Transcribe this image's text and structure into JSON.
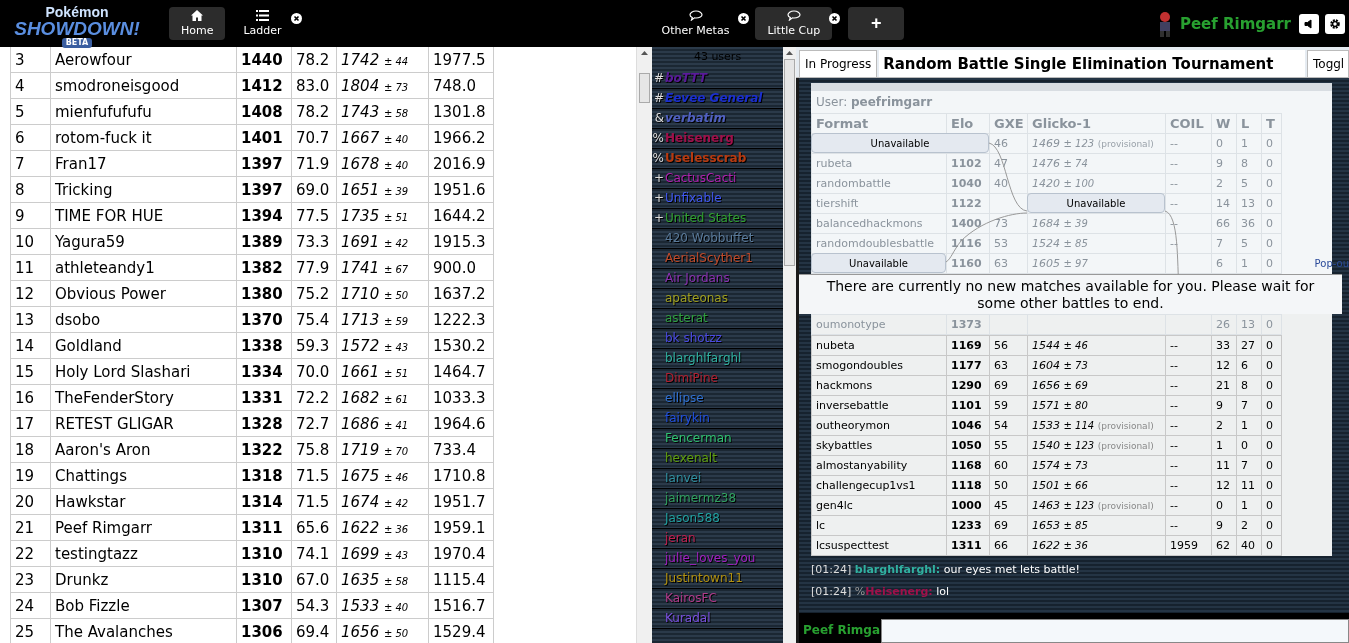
{
  "header": {
    "logo": {
      "top": "Pokémon",
      "main": "SHOWDOWN!",
      "badge": "BETA"
    },
    "tabs": [
      {
        "kind": "home",
        "label": "Home",
        "selected": true,
        "closable": false
      },
      {
        "kind": "ladder",
        "label": "Ladder",
        "selected": false,
        "closable": true
      }
    ],
    "rooms": [
      {
        "label": "Other Metas",
        "selected": false,
        "closable": true
      },
      {
        "label": "Little Cup",
        "selected": true,
        "closable": true
      }
    ],
    "add_button": "+",
    "user": {
      "name": "Peef Rimgarr"
    }
  },
  "ladder": {
    "rows": [
      {
        "rank": "3",
        "name": "Aerowfour",
        "elo": "1440",
        "gxe": "78.2",
        "glicko": "1742",
        "dev": "± 44",
        "coil": "1977.5"
      },
      {
        "rank": "4",
        "name": "smodroneisgood",
        "elo": "1412",
        "gxe": "83.0",
        "glicko": "1804",
        "dev": "± 73",
        "coil": "748.0"
      },
      {
        "rank": "5",
        "name": "mienfufufufu",
        "elo": "1408",
        "gxe": "78.2",
        "glicko": "1743",
        "dev": "± 58",
        "coil": "1301.8"
      },
      {
        "rank": "6",
        "name": "rotom-fuck it",
        "elo": "1401",
        "gxe": "70.7",
        "glicko": "1667",
        "dev": "± 40",
        "coil": "1966.2"
      },
      {
        "rank": "7",
        "name": "Fran17",
        "elo": "1397",
        "gxe": "71.9",
        "glicko": "1678",
        "dev": "± 40",
        "coil": "2016.9"
      },
      {
        "rank": "8",
        "name": "Tricking",
        "elo": "1397",
        "gxe": "69.0",
        "glicko": "1651",
        "dev": "± 39",
        "coil": "1951.6"
      },
      {
        "rank": "9",
        "name": "TIME FOR HUE",
        "elo": "1394",
        "gxe": "77.5",
        "glicko": "1735",
        "dev": "± 51",
        "coil": "1644.2"
      },
      {
        "rank": "10",
        "name": "Yagura59",
        "elo": "1389",
        "gxe": "73.3",
        "glicko": "1691",
        "dev": "± 42",
        "coil": "1915.3"
      },
      {
        "rank": "11",
        "name": "athleteandy1",
        "elo": "1382",
        "gxe": "77.9",
        "glicko": "1741",
        "dev": "± 67",
        "coil": "900.0"
      },
      {
        "rank": "12",
        "name": "Obvious Power",
        "elo": "1380",
        "gxe": "75.2",
        "glicko": "1710",
        "dev": "± 50",
        "coil": "1637.2"
      },
      {
        "rank": "13",
        "name": "dsobo",
        "elo": "1370",
        "gxe": "75.4",
        "glicko": "1713",
        "dev": "± 59",
        "coil": "1222.3"
      },
      {
        "rank": "14",
        "name": "Goldland",
        "elo": "1338",
        "gxe": "59.3",
        "glicko": "1572",
        "dev": "± 43",
        "coil": "1530.2"
      },
      {
        "rank": "15",
        "name": "Holy Lord Slashari",
        "elo": "1334",
        "gxe": "70.0",
        "glicko": "1661",
        "dev": "± 51",
        "coil": "1464.7"
      },
      {
        "rank": "16",
        "name": "TheFenderStory",
        "elo": "1331",
        "gxe": "72.2",
        "glicko": "1682",
        "dev": "± 61",
        "coil": "1033.3"
      },
      {
        "rank": "17",
        "name": "RETEST GLIGAR",
        "elo": "1328",
        "gxe": "72.7",
        "glicko": "1686",
        "dev": "± 41",
        "coil": "1964.6"
      },
      {
        "rank": "18",
        "name": "Aaron's Aron",
        "elo": "1322",
        "gxe": "75.8",
        "glicko": "1719",
        "dev": "± 70",
        "coil": "733.4"
      },
      {
        "rank": "19",
        "name": "Chattings",
        "elo": "1318",
        "gxe": "71.5",
        "glicko": "1675",
        "dev": "± 46",
        "coil": "1710.8"
      },
      {
        "rank": "20",
        "name": "Hawkstar",
        "elo": "1314",
        "gxe": "71.5",
        "glicko": "1674",
        "dev": "± 42",
        "coil": "1951.7"
      },
      {
        "rank": "21",
        "name": "Peef Rimgarr",
        "elo": "1311",
        "gxe": "65.6",
        "glicko": "1622",
        "dev": "± 36",
        "coil": "1959.1"
      },
      {
        "rank": "22",
        "name": "testingtazz",
        "elo": "1310",
        "gxe": "74.1",
        "glicko": "1699",
        "dev": "± 43",
        "coil": "1970.4"
      },
      {
        "rank": "23",
        "name": "Drunkz",
        "elo": "1310",
        "gxe": "67.0",
        "glicko": "1635",
        "dev": "± 58",
        "coil": "1115.4"
      },
      {
        "rank": "24",
        "name": "Bob Fizzle",
        "elo": "1307",
        "gxe": "54.3",
        "glicko": "1533",
        "dev": "± 40",
        "coil": "1516.7"
      },
      {
        "rank": "25",
        "name": "The Avalanches",
        "elo": "1306",
        "gxe": "69.4",
        "glicko": "1656",
        "dev": "± 50",
        "coil": "1529.4"
      }
    ]
  },
  "userlist": {
    "count": "43 users",
    "users": [
      {
        "group": "#",
        "name": "boTTT",
        "color": "#5a1a9a",
        "kind": "staff"
      },
      {
        "group": "#",
        "name": "Eevee General",
        "color": "#1a2fd0",
        "kind": "staff"
      },
      {
        "group": "&",
        "name": "verbatim",
        "color": "#5060c0",
        "kind": "staff"
      },
      {
        "group": "%",
        "name": "Heisenerg",
        "color": "#a0104a",
        "kind": "driver"
      },
      {
        "group": "%",
        "name": "Uselesscrab",
        "color": "#b83a10",
        "kind": "driver"
      },
      {
        "group": "+",
        "name": "CactusCacti",
        "color": "#b020b0",
        "kind": "regular"
      },
      {
        "group": "+",
        "name": "Unfixable",
        "color": "#4058f0",
        "kind": "regular"
      },
      {
        "group": "+",
        "name": "United States",
        "color": "#30a030",
        "kind": "regular"
      },
      {
        "name": "420 Wobbuffet",
        "color": "#5a7a9a",
        "kind": "regular"
      },
      {
        "name": "AerialScyther1",
        "color": "#c04a2a",
        "kind": "regular"
      },
      {
        "name": "Air Jordans",
        "color": "#8a30b0",
        "kind": "regular"
      },
      {
        "name": "apateonas",
        "color": "#a0a020",
        "kind": "regular"
      },
      {
        "name": "asterat",
        "color": "#30a040",
        "kind": "regular"
      },
      {
        "name": "bk shotzz",
        "color": "#4a4ae0",
        "kind": "regular"
      },
      {
        "name": "blarghlfarghl",
        "color": "#30b0a0",
        "kind": "regular"
      },
      {
        "name": "DimiPine",
        "color": "#b02030",
        "kind": "regular"
      },
      {
        "name": "ellipse",
        "color": "#3070d0",
        "kind": "regular"
      },
      {
        "name": "fairykin",
        "color": "#2050e0",
        "kind": "regular"
      },
      {
        "name": "Fencerman",
        "color": "#30c070",
        "kind": "regular"
      },
      {
        "name": "hexenalt",
        "color": "#60a010",
        "kind": "regular"
      },
      {
        "name": "Ianvei",
        "color": "#3090a0",
        "kind": "regular"
      },
      {
        "name": "jaimermz38",
        "color": "#30a060",
        "kind": "regular"
      },
      {
        "name": "Jason588",
        "color": "#20a0a0",
        "kind": "regular"
      },
      {
        "name": "jeran",
        "color": "#c02050",
        "kind": "regular"
      },
      {
        "name": "julie_loves_you",
        "color": "#a020c0",
        "kind": "regular"
      },
      {
        "name": "Justintown11",
        "color": "#b09010",
        "kind": "regular"
      },
      {
        "name": "KairosFC",
        "color": "#b03a8a",
        "kind": "regular"
      },
      {
        "name": "Kuradal",
        "color": "#7a50e0",
        "kind": "regular"
      }
    ]
  },
  "tournament": {
    "tab": "In Progress",
    "title": "Random Battle Single Elimination Tournament",
    "toggle": "Toggl",
    "bracket_nodes": [
      "Unavailable",
      "Unavailable",
      "Unavailable"
    ],
    "popout": "Pop-ou",
    "message": "There are currently no new matches available for you. Please wait for some other battles to end."
  },
  "stats": {
    "user_label": "User:",
    "user": "peefrimgarr",
    "columns": [
      "Format",
      "Elo",
      "GXE",
      "Glicko-1",
      "COIL",
      "W",
      "L",
      "T"
    ],
    "faded_rows": [
      {
        "gxe": "46",
        "glicko": "1469",
        "dev": "± 123",
        "provisional": "(provisional)",
        "coil": "--",
        "w": "0",
        "l": "1",
        "t": "0"
      },
      {
        "format": "rubeta",
        "elo": "1102",
        "gxe": "47",
        "glicko": "1476",
        "dev": "± 74",
        "coil": "--",
        "w": "9",
        "l": "8",
        "t": "0"
      },
      {
        "format": "randombattle",
        "elo": "1040",
        "gxe": "40",
        "glicko": "1420",
        "dev": "± 100",
        "coil": "--",
        "w": "2",
        "l": "5",
        "t": "0"
      },
      {
        "format": "tiershift",
        "elo": "1122",
        "coil": "--",
        "w": "14",
        "l": "13",
        "t": "0"
      },
      {
        "format": "balancedhackmons",
        "elo": "1400",
        "gxe": "73",
        "glicko": "1684",
        "dev": "± 39",
        "coil": "--",
        "w": "66",
        "l": "36",
        "t": "0"
      },
      {
        "format": "randomdoublesbattle",
        "elo": "1116",
        "gxe": "53",
        "glicko": "1524",
        "dev": "± 85",
        "coil": "--",
        "w": "7",
        "l": "5",
        "t": "0"
      },
      {
        "elo": "1160",
        "gxe": "63",
        "glicko": "1605",
        "dev": "± 97",
        "w": "6",
        "l": "1",
        "t": "0"
      }
    ],
    "after_rows": [
      {
        "format": "oumonotype",
        "elo": "1373",
        "w": "26",
        "l": "13",
        "t": "0"
      }
    ],
    "rows": [
      {
        "format": "nubeta",
        "elo": "1169",
        "gxe": "56",
        "glicko": "1544",
        "dev": "± 46",
        "coil": "--",
        "w": "33",
        "l": "27",
        "t": "0"
      },
      {
        "format": "smogondoubles",
        "elo": "1177",
        "gxe": "63",
        "glicko": "1604",
        "dev": "± 73",
        "coil": "--",
        "w": "12",
        "l": "6",
        "t": "0"
      },
      {
        "format": "hackmons",
        "elo": "1290",
        "gxe": "69",
        "glicko": "1656",
        "dev": "± 69",
        "coil": "--",
        "w": "21",
        "l": "8",
        "t": "0"
      },
      {
        "format": "inversebattle",
        "elo": "1101",
        "gxe": "59",
        "glicko": "1571",
        "dev": "± 80",
        "coil": "--",
        "w": "9",
        "l": "7",
        "t": "0"
      },
      {
        "format": "outheorymon",
        "elo": "1046",
        "gxe": "54",
        "glicko": "1533",
        "dev": "± 114",
        "provisional": "(provisional)",
        "coil": "--",
        "w": "2",
        "l": "1",
        "t": "0"
      },
      {
        "format": "skybattles",
        "elo": "1050",
        "gxe": "55",
        "glicko": "1540",
        "dev": "± 123",
        "provisional": "(provisional)",
        "coil": "--",
        "w": "1",
        "l": "0",
        "t": "0"
      },
      {
        "format": "almostanyability",
        "elo": "1168",
        "gxe": "60",
        "glicko": "1574",
        "dev": "± 73",
        "coil": "--",
        "w": "11",
        "l": "7",
        "t": "0"
      },
      {
        "format": "challengecup1vs1",
        "elo": "1118",
        "gxe": "50",
        "glicko": "1501",
        "dev": "± 66",
        "coil": "--",
        "w": "12",
        "l": "11",
        "t": "0"
      },
      {
        "format": "gen4lc",
        "elo": "1000",
        "gxe": "45",
        "glicko": "1463",
        "dev": "± 123",
        "provisional": "(provisional)",
        "coil": "--",
        "w": "0",
        "l": "1",
        "t": "0"
      },
      {
        "format": "lc",
        "elo": "1233",
        "gxe": "69",
        "glicko": "1653",
        "dev": "± 85",
        "coil": "--",
        "w": "9",
        "l": "2",
        "t": "0"
      },
      {
        "format": "lcsuspecttest",
        "elo": "1311",
        "gxe": "66",
        "glicko": "1622",
        "dev": "± 36",
        "coil": "1959",
        "w": "62",
        "l": "40",
        "t": "0"
      }
    ]
  },
  "chat": [
    {
      "time": "[01:24]",
      "name": "blarghlfarghl:",
      "color": "#30b0a0",
      "text": "our eyes met lets battle!"
    },
    {
      "time": "[01:24]",
      "group": "%",
      "name": "Heisenerg:",
      "color": "#a0104a",
      "text": "lol"
    }
  ],
  "composer": {
    "name": "Peef Rimga"
  }
}
